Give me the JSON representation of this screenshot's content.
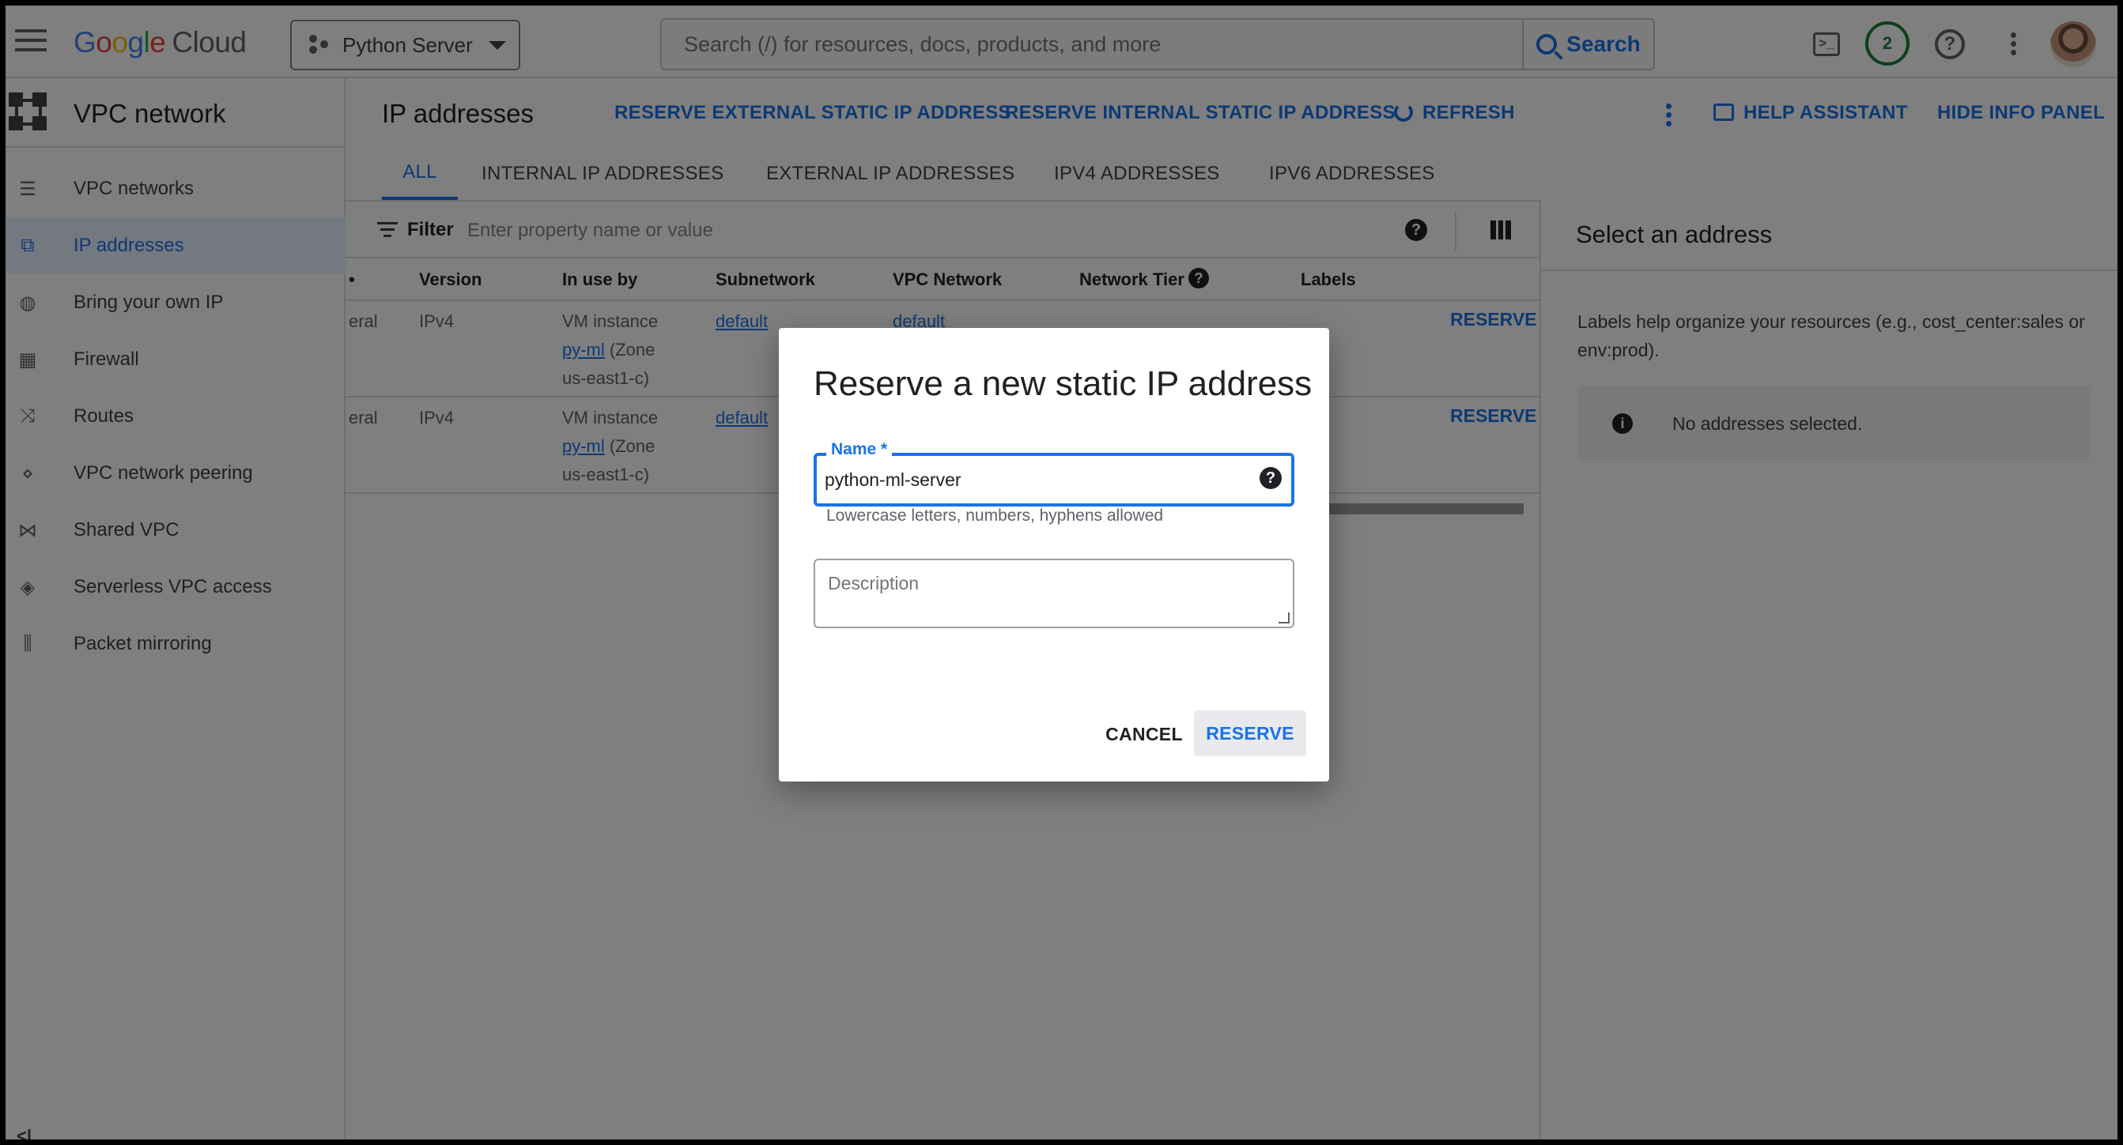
{
  "topbar": {
    "brand": "Google Cloud",
    "project_name": "Python Server",
    "search_placeholder": "Search (/) for resources, docs, products, and more",
    "search_button": "Search",
    "notifications_count": "2"
  },
  "sidebar": {
    "title": "VPC network",
    "items": [
      {
        "label": "VPC networks",
        "icon": "vpc-networks-icon"
      },
      {
        "label": "IP addresses",
        "icon": "ip-addresses-icon",
        "active": true
      },
      {
        "label": "Bring your own IP",
        "icon": "globe-icon"
      },
      {
        "label": "Firewall",
        "icon": "firewall-icon"
      },
      {
        "label": "Routes",
        "icon": "routes-icon"
      },
      {
        "label": "VPC network peering",
        "icon": "peering-icon"
      },
      {
        "label": "Shared VPC",
        "icon": "shared-vpc-icon"
      },
      {
        "label": "Serverless VPC access",
        "icon": "serverless-icon"
      },
      {
        "label": "Packet mirroring",
        "icon": "packet-mirroring-icon"
      }
    ]
  },
  "toolbar": {
    "page_title": "IP addresses",
    "reserve_external": "RESERVE EXTERNAL STATIC IP ADDRESS",
    "reserve_internal": "RESERVE INTERNAL STATIC IP ADDRESS",
    "refresh": "REFRESH",
    "help_assistant": "HELP ASSISTANT",
    "hide_info_panel": "HIDE INFO PANEL"
  },
  "tabs": [
    "ALL",
    "INTERNAL IP ADDRESSES",
    "EXTERNAL IP ADDRESSES",
    "IPV4 ADDRESSES",
    "IPV6 ADDRESSES"
  ],
  "filter": {
    "label": "Filter",
    "placeholder": "Enter property name or value"
  },
  "table": {
    "partial_col_header": "•",
    "headers": [
      "Version",
      "In use by",
      "Subnetwork",
      "VPC Network",
      "Network Tier",
      "Labels"
    ],
    "rows": [
      {
        "type_partial": "eral",
        "version": "IPv4",
        "in_use_prefix": "VM instance",
        "in_use_link": "py-ml",
        "in_use_suffix": "(Zone",
        "in_use_zone": "us-east1-c)",
        "subnetwork": "default",
        "vpc_network": "default",
        "action": "RESERVE"
      },
      {
        "type_partial": "eral",
        "version": "IPv4",
        "in_use_prefix": "VM instance",
        "in_use_link": "py-ml",
        "in_use_suffix": "(Zone",
        "in_use_zone": "us-east1-c)",
        "subnetwork": "default",
        "vpc_network": "",
        "action": "RESERVE"
      }
    ]
  },
  "info_panel": {
    "title": "Select an address",
    "description": "Labels help organize your resources (e.g., cost_center:sales or env:prod).",
    "empty_message": "No addresses selected."
  },
  "dialog": {
    "title": "Reserve a new static IP address",
    "name_label": "Name *",
    "name_value": "python-ml-server",
    "name_hint": "Lowercase letters, numbers, hyphens allowed",
    "description_placeholder": "Description",
    "cancel": "CANCEL",
    "reserve": "RESERVE"
  },
  "colors": {
    "accent": "#1a73e8",
    "notification_ring": "#188038"
  }
}
